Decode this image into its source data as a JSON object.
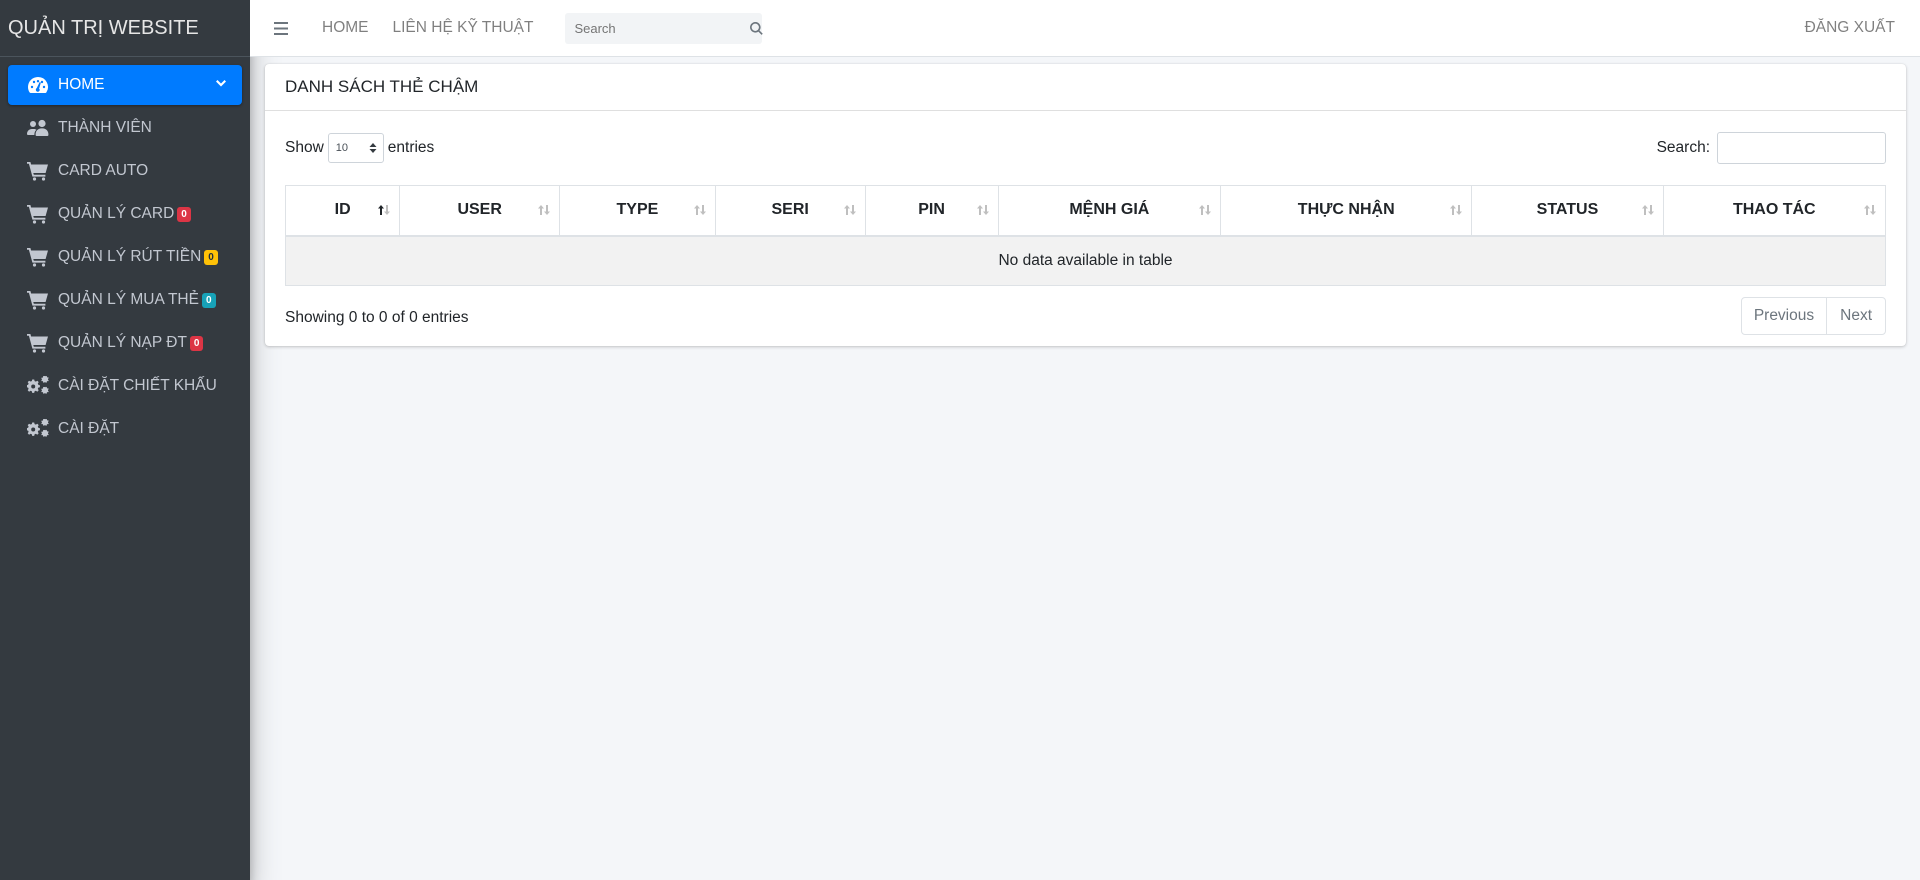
{
  "brand": {
    "title": "QUẢN TRỊ WEBSITE"
  },
  "sidebar": {
    "items": [
      {
        "label": "HOME",
        "icon": "tachometer-icon",
        "active": true
      },
      {
        "label": "THÀNH VIÊN",
        "icon": "users-icon"
      },
      {
        "label": "CARD AUTO",
        "icon": "cart-icon"
      },
      {
        "label": "QUẢN LÝ CARD",
        "icon": "cart-icon",
        "badge": "0",
        "badge_color": "#dc3545"
      },
      {
        "label": "QUẢN LÝ RÚT TIỀN",
        "icon": "cart-icon",
        "badge": "0",
        "badge_color": "#ffc107"
      },
      {
        "label": "QUẢN LÝ MUA THẺ",
        "icon": "cart-icon",
        "badge": "0",
        "badge_color": "#17a2b8"
      },
      {
        "label": "QUẢN LÝ NẠP ĐT",
        "icon": "cart-icon",
        "badge": "0",
        "badge_color": "#dc3545"
      },
      {
        "label": "CÀI ĐẶT CHIẾT KHẤU",
        "icon": "cogs-icon"
      },
      {
        "label": "CÀI ĐẶT",
        "icon": "cogs-icon"
      }
    ]
  },
  "topbar": {
    "links": [
      "HOME",
      "LIÊN HỆ KỸ THUẬT"
    ],
    "search_placeholder": "Search",
    "logout": "ĐĂNG XUẤT"
  },
  "card": {
    "title": "DANH SÁCH THẺ CHẬM",
    "show_label": "Show",
    "entries_value": "10",
    "entries_label": "entries",
    "search_label": "Search:",
    "columns": [
      "ID",
      "USER",
      "TYPE",
      "SERI",
      "PIN",
      "MỆNH GIÁ",
      "THỰC NHẬN",
      "STATUS",
      "THAO TÁC"
    ],
    "empty_message": "No data available in table",
    "info": "Showing 0 to 0 of 0 entries",
    "previous": "Previous",
    "next": "Next"
  },
  "colors": {
    "primary": "#007bff",
    "sidebar_bg": "#343a40",
    "page_bg": "#f4f6f9"
  }
}
